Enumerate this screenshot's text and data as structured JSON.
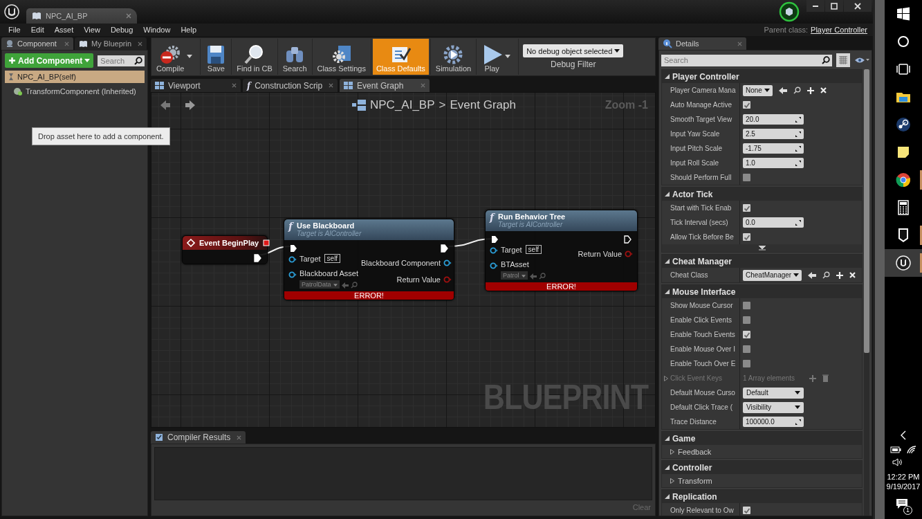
{
  "title_bar": {
    "tab": "NPC_AI_BP"
  },
  "menu_bar": {
    "items": [
      "File",
      "Edit",
      "Asset",
      "View",
      "Debug",
      "Window",
      "Help"
    ],
    "parent_class_label": "Parent class:",
    "parent_class": "Player Controller"
  },
  "components_panel": {
    "tabs": [
      {
        "label": "Component",
        "kind": "components",
        "selected": true
      },
      {
        "label": "My Blueprin",
        "kind": "blueprint",
        "selected": false
      }
    ],
    "add_button": "Add Component",
    "search": {
      "placeholder": "Search"
    },
    "items": [
      {
        "label": "NPC_AI_BP(self)",
        "kind": "actor",
        "selected": true
      },
      {
        "label": "TransformComponent (Inherited)",
        "kind": "transform",
        "selected": false
      }
    ],
    "tooltip": "Drop asset here to add a component."
  },
  "toolbar": {
    "buttons": [
      {
        "label": "Compile",
        "kind": "compile",
        "selected": false,
        "dropdown": true
      },
      {
        "label": "Save",
        "kind": "save",
        "selected": false,
        "dropdown": false
      },
      {
        "label": "Find in CB",
        "kind": "find",
        "selected": false,
        "dropdown": false
      },
      {
        "label": "Search",
        "kind": "search",
        "selected": false,
        "dropdown": false
      },
      {
        "label": "Class Settings",
        "kind": "class_settings",
        "selected": false,
        "dropdown": false
      },
      {
        "label": "Class Defaults",
        "kind": "class_defaults",
        "selected": true,
        "dropdown": false
      },
      {
        "label": "Simulation",
        "kind": "simulation",
        "selected": false,
        "dropdown": false
      },
      {
        "label": "Play",
        "kind": "play",
        "selected": false,
        "dropdown": true
      }
    ],
    "debug_filter": {
      "value": "No debug object selected",
      "label": "Debug Filter"
    }
  },
  "graph_tabs": [
    {
      "label": "Viewport",
      "kind": "viewport",
      "selected": false
    },
    {
      "label": "Construction Scrip",
      "kind": "function",
      "icon": "f",
      "selected": false
    },
    {
      "label": "Event Graph",
      "kind": "graph",
      "selected": true
    }
  ],
  "graph": {
    "breadcrumb": {
      "blueprint": "NPC_AI_BP",
      "separator": ">",
      "graph": "Event Graph"
    },
    "zoom": "Zoom -1",
    "watermark": "BLUEPRINT",
    "nodes": [
      {
        "kind": "event",
        "title": "Event BeginPlay",
        "exec_out_connected": true
      },
      {
        "kind": "function",
        "icon": "f",
        "title": "Use Blackboard",
        "subtitle": "Target is AIController",
        "exec_out_connected": true,
        "inputs": [
          {
            "label": "Target",
            "kind": "self",
            "value": "self",
            "color": "#2b9fd9"
          },
          {
            "label": "Blackboard Asset",
            "kind": "asset",
            "value": "PatrolData",
            "color": "#2b9fd9"
          }
        ],
        "outputs": [
          {
            "label": "Blackboard Component",
            "color": "#2b9fd9"
          },
          {
            "label": "Return Value",
            "color": "#a01010"
          }
        ],
        "error": "ERROR!"
      },
      {
        "kind": "function",
        "icon": "f",
        "title": "Run Behavior Tree",
        "subtitle": "Target is AIController",
        "exec_out_connected": false,
        "inputs": [
          {
            "label": "Target",
            "kind": "self",
            "value": "self",
            "color": "#2b9fd9"
          },
          {
            "label": "BTAsset",
            "kind": "asset",
            "value": "Patrol",
            "color": "#2b9fd9"
          }
        ],
        "outputs": [
          {
            "label": "Return Value",
            "color": "#a01010"
          }
        ],
        "error": "ERROR!"
      }
    ]
  },
  "compiler": {
    "tab": "Compiler Results",
    "clear": {
      "label": "Clear",
      "disabled": true
    }
  },
  "details": {
    "tab": "Details",
    "search": {
      "placeholder": "Search"
    },
    "sections": [
      {
        "title": "Player Controller",
        "expanded": true,
        "advanced": false,
        "rows": [
          {
            "kind": "object",
            "label": "Player Camera Mana",
            "value": "None"
          },
          {
            "kind": "check",
            "label": "Auto Manage Active",
            "checked": true
          },
          {
            "kind": "number",
            "label": "Smooth Target View",
            "value": "20.0"
          },
          {
            "kind": "number",
            "label": "Input Yaw Scale",
            "value": "2.5"
          },
          {
            "kind": "number",
            "label": "Input Pitch Scale",
            "value": "-1.75"
          },
          {
            "kind": "number",
            "label": "Input Roll Scale",
            "value": "1.0"
          },
          {
            "kind": "check",
            "label": "Should Perform Full",
            "checked": false
          }
        ]
      },
      {
        "title": "Actor Tick",
        "expanded": true,
        "advanced": true,
        "rows": [
          {
            "kind": "check",
            "label": "Start with Tick Enab",
            "checked": true
          },
          {
            "kind": "number",
            "label": "Tick Interval (secs)",
            "value": "0.0"
          },
          {
            "kind": "check",
            "label": "Allow Tick Before Be",
            "checked": true
          }
        ]
      },
      {
        "title": "Cheat Manager",
        "expanded": true,
        "advanced": false,
        "rows": [
          {
            "kind": "object",
            "label": "Cheat Class",
            "value": "CheatManager"
          }
        ]
      },
      {
        "title": "Mouse Interface",
        "expanded": true,
        "advanced": false,
        "rows": [
          {
            "kind": "check",
            "label": "Show Mouse Cursor",
            "checked": false
          },
          {
            "kind": "check",
            "label": "Enable Click Events",
            "checked": false
          },
          {
            "kind": "check",
            "label": "Enable Touch Events",
            "checked": true
          },
          {
            "kind": "check",
            "label": "Enable Mouse Over I",
            "checked": false
          },
          {
            "kind": "check",
            "label": "Enable Touch Over E",
            "checked": false
          },
          {
            "kind": "array",
            "label": "Click Event Keys",
            "value": "1 Array elements"
          },
          {
            "kind": "enum",
            "label": "Default Mouse Curso",
            "value": "Default"
          },
          {
            "kind": "enum",
            "label": "Default Click Trace (",
            "value": "Visibility"
          },
          {
            "kind": "number",
            "label": "Trace Distance",
            "value": "100000.0"
          }
        ]
      },
      {
        "title": "Game",
        "expanded": true,
        "advanced": false,
        "rows": [
          {
            "kind": "category",
            "label": "Feedback"
          }
        ]
      },
      {
        "title": "Controller",
        "expanded": true,
        "advanced": false,
        "rows": [
          {
            "kind": "category",
            "label": "Transform"
          }
        ]
      },
      {
        "title": "Replication",
        "expanded": true,
        "advanced": false,
        "rows": [
          {
            "kind": "check",
            "label": "Only Relevant to Ow",
            "checked": true
          }
        ]
      }
    ]
  },
  "taskbar": {
    "apps": [
      {
        "kind": "start",
        "selected": false,
        "running": false
      },
      {
        "kind": "cortana",
        "selected": false,
        "running": false
      },
      {
        "kind": "taskview",
        "selected": false,
        "running": false
      },
      {
        "kind": "explorer",
        "selected": false,
        "running": false
      },
      {
        "kind": "steam",
        "selected": false,
        "running": false
      },
      {
        "kind": "notes",
        "selected": false,
        "running": false
      },
      {
        "kind": "chrome",
        "selected": false,
        "running": true
      },
      {
        "kind": "calculator",
        "selected": false,
        "running": false
      },
      {
        "kind": "epic",
        "selected": false,
        "running": true
      },
      {
        "kind": "unreal",
        "selected": true,
        "running": true
      }
    ],
    "time": "12:22 PM",
    "date": "9/19/2017",
    "notifications": "1"
  }
}
